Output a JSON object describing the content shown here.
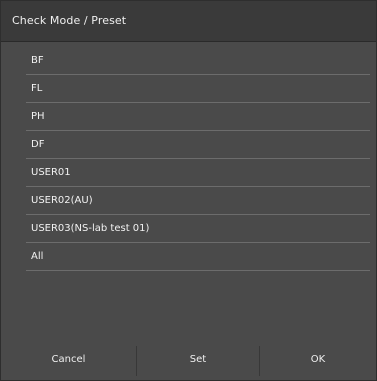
{
  "dialog": {
    "title": "Check Mode / Preset"
  },
  "presets": [
    {
      "label": "BF"
    },
    {
      "label": "FL"
    },
    {
      "label": "PH"
    },
    {
      "label": "DF"
    },
    {
      "label": "USER01"
    },
    {
      "label": "USER02(AU)"
    },
    {
      "label": "USER03(NS-lab test 01)"
    },
    {
      "label": "All"
    }
  ],
  "footer": {
    "cancel_label": "Cancel",
    "set_label": "Set",
    "ok_label": "OK"
  }
}
